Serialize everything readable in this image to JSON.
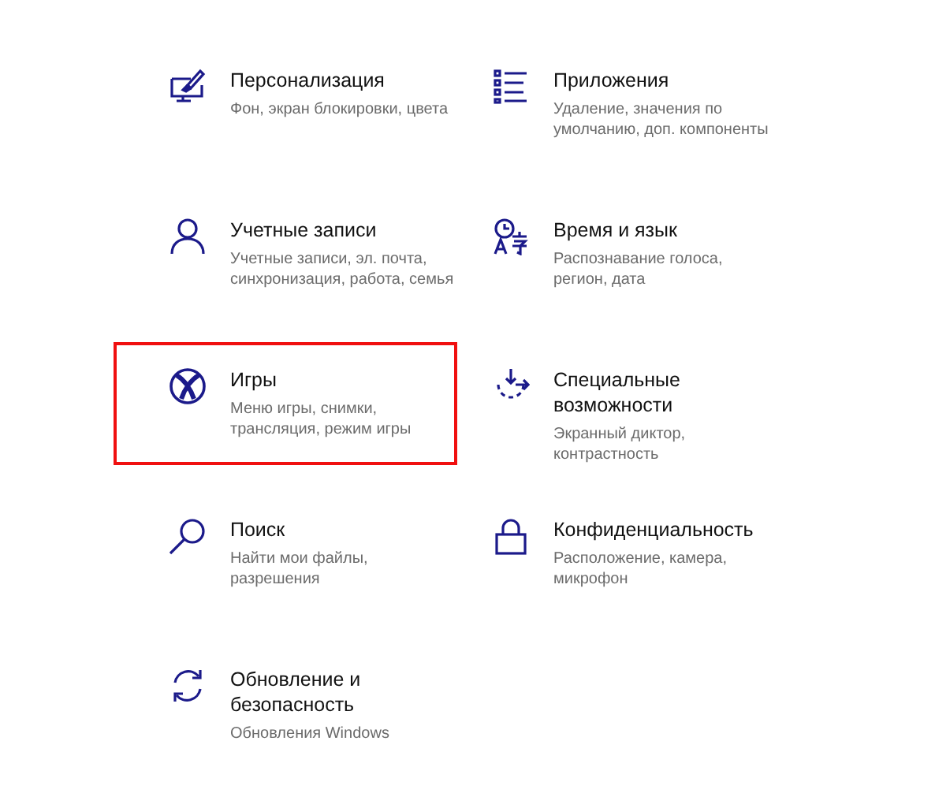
{
  "categories": [
    {
      "title": "Персонализация",
      "description": "Фон, экран блокировки, цвета",
      "highlighted": false
    },
    {
      "title": "Приложения",
      "description": "Удаление, значения по\nумолчанию, доп. компоненты",
      "highlighted": false
    },
    {
      "title": "Учетные записи",
      "description": "Учетные записи, эл. почта,\nсинхронизация, работа, семья",
      "highlighted": false
    },
    {
      "title": "Время и язык",
      "description": "Распознавание голоса,\nрегион, дата",
      "highlighted": false
    },
    {
      "title": "Игры",
      "description": "Меню игры, снимки,\nтрансляция, режим игры",
      "highlighted": true
    },
    {
      "title": "Специальные\nвозможности",
      "description": "Экранный диктор,\nконтрастность",
      "highlighted": false
    },
    {
      "title": "Поиск",
      "description": "Найти мои файлы,\nразрешения",
      "highlighted": false
    },
    {
      "title": "Конфиденциальность",
      "description": "Расположение, камера,\nмикрофон",
      "highlighted": false
    },
    {
      "title": "Обновление и\nбезопасность",
      "description": "Обновления Windows",
      "highlighted": false
    }
  ]
}
